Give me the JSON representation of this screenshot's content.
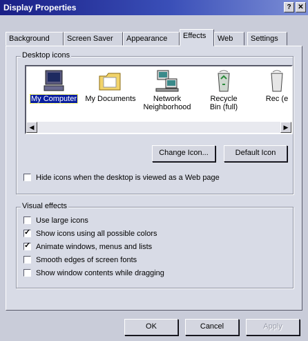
{
  "window": {
    "title": "Display Properties",
    "help_button": "?",
    "close_button": "✕"
  },
  "tabs": [
    "Background",
    "Screen Saver",
    "Appearance",
    "Effects",
    "Web",
    "Settings"
  ],
  "active_tab": "Effects",
  "desktop_icons": {
    "legend": "Desktop icons",
    "items": [
      {
        "label": "My Computer",
        "icon": "computer-icon",
        "selected": true
      },
      {
        "label": "My Documents",
        "icon": "folder-icon",
        "selected": false
      },
      {
        "label": "Network Neighborhood",
        "icon": "network-icon",
        "selected": false
      },
      {
        "label": "Recycle Bin (full)",
        "icon": "recycle-bin-icon",
        "selected": false
      },
      {
        "label": "Rec (e",
        "icon": "recycle-bin-icon",
        "selected": false
      }
    ],
    "change_icon_button": "Change Icon...",
    "default_icon_button": "Default Icon",
    "hide_icons_checkbox": {
      "label": "Hide icons when the desktop is viewed as a Web page",
      "checked": false
    }
  },
  "visual_effects": {
    "legend": "Visual effects",
    "options": [
      {
        "label": "Use large icons",
        "checked": false
      },
      {
        "label": "Show icons using all possible colors",
        "checked": true
      },
      {
        "label": "Animate windows, menus and lists",
        "checked": true
      },
      {
        "label": "Smooth edges of screen fonts",
        "checked": false
      },
      {
        "label": "Show window contents while dragging",
        "checked": false
      }
    ]
  },
  "buttons": {
    "ok": "OK",
    "cancel": "Cancel",
    "apply": "Apply"
  }
}
